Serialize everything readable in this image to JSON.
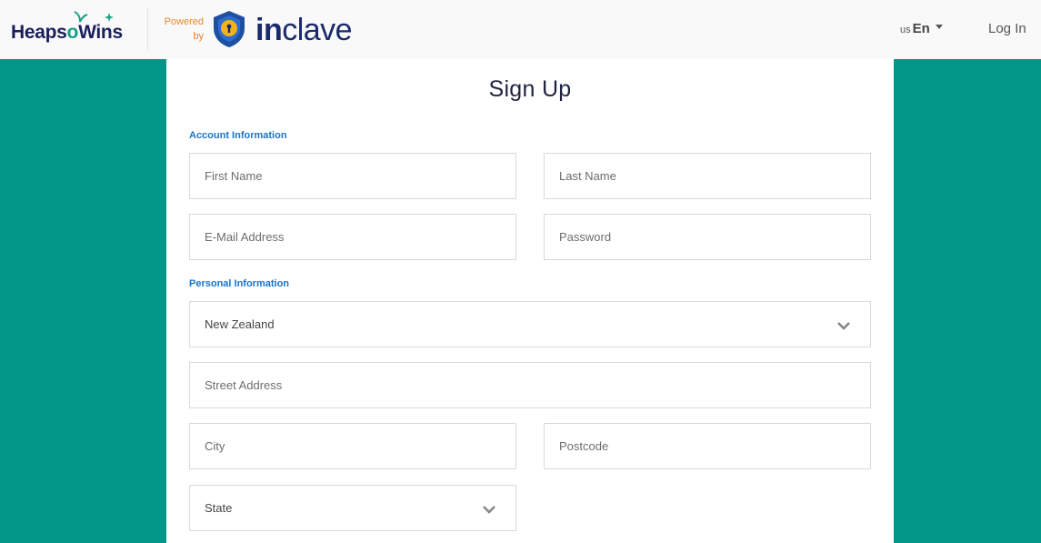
{
  "header": {
    "brand_heaps": "Heaps",
    "brand_o": "o",
    "brand_wins": "Wins",
    "powered_line1": "Powered",
    "powered_line2": "by",
    "inclave_in": "in",
    "inclave_rest": "clave",
    "lang_flag": "us",
    "lang_code": "En",
    "login_label": "Log In"
  },
  "form": {
    "title": "Sign Up",
    "account_section": "Account Information",
    "personal_section": "Personal Information",
    "first_name_placeholder": "First Name",
    "last_name_placeholder": "Last Name",
    "email_placeholder": "E-Mail Address",
    "password_placeholder": "Password",
    "country_value": "New Zealand",
    "street_placeholder": "Street Address",
    "city_placeholder": "City",
    "postcode_placeholder": "Postcode",
    "state_placeholder": "State"
  },
  "colors": {
    "background": "#009688",
    "section_label": "#1a74c8",
    "powered_by": "#e8872e",
    "brand_navy": "#1b2a6b"
  },
  "icons": {
    "heaps_logo": "sprout-icon",
    "inclave_logo": "shield-lock-icon",
    "lang_caret": "caret-down-icon",
    "select_chevron": "chevron-down-icon"
  }
}
